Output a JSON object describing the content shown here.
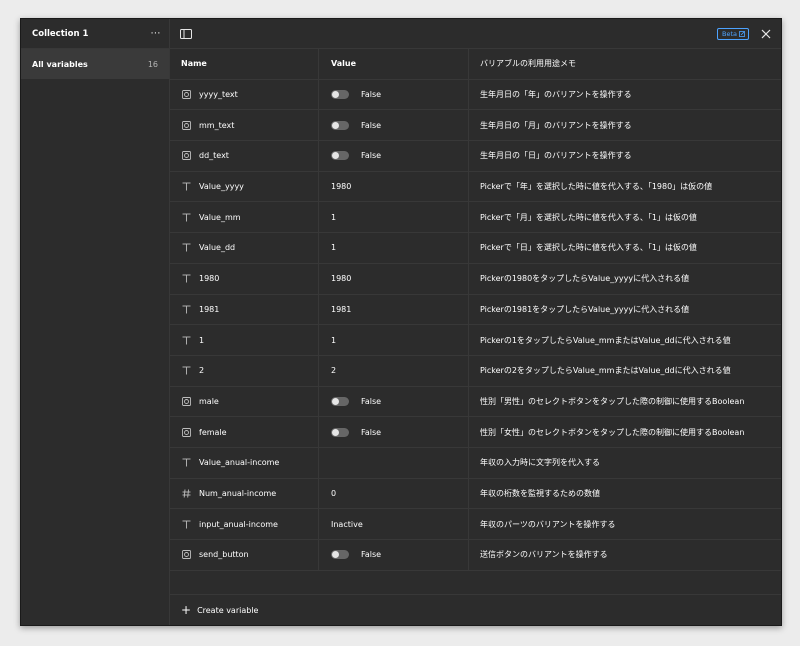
{
  "sidebar": {
    "collection_title": "Collection 1",
    "more_icon": "⋯",
    "items": [
      {
        "label": "All variables",
        "count": "16"
      }
    ]
  },
  "topbar": {
    "beta_label": "Beta"
  },
  "table": {
    "headers": {
      "name": "Name",
      "value": "Value",
      "memo": "バリアブルの利用用途メモ"
    },
    "rows": [
      {
        "type": "boolean",
        "name": "yyyy_text",
        "value": "False",
        "memo": "生年月日の「年」のバリアントを操作する"
      },
      {
        "type": "boolean",
        "name": "mm_text",
        "value": "False",
        "memo": "生年月日の「月」のバリアントを操作する"
      },
      {
        "type": "boolean",
        "name": "dd_text",
        "value": "False",
        "memo": "生年月日の「日」のバリアントを操作する"
      },
      {
        "type": "string",
        "name": "Value_yyyy",
        "value": "1980",
        "memo": "Pickerで「年」を選択した時に値を代入する、「1980」は仮の値"
      },
      {
        "type": "string",
        "name": "Value_mm",
        "value": "1",
        "memo": "Pickerで「月」を選択した時に値を代入する、「1」は仮の値"
      },
      {
        "type": "string",
        "name": "Value_dd",
        "value": "1",
        "memo": "Pickerで「日」を選択した時に値を代入する、「1」は仮の値"
      },
      {
        "type": "string",
        "name": "1980",
        "value": "1980",
        "memo": "Pickerの1980をタップしたらValue_yyyyに代入される値"
      },
      {
        "type": "string",
        "name": "1981",
        "value": "1981",
        "memo": "Pickerの1981をタップしたらValue_yyyyに代入される値"
      },
      {
        "type": "string",
        "name": "1",
        "value": "1",
        "memo": "Pickerの1をタップしたらValue_mmまたはValue_ddに代入される値"
      },
      {
        "type": "string",
        "name": "2",
        "value": "2",
        "memo": "Pickerの2をタップしたらValue_mmまたはValue_ddに代入される値"
      },
      {
        "type": "boolean",
        "name": "male",
        "value": "False",
        "memo": "性別「男性」のセレクトボタンをタップした際の制御に使用するBoolean"
      },
      {
        "type": "boolean",
        "name": "female",
        "value": "False",
        "memo": "性別「女性」のセレクトボタンをタップした際の制御に使用するBoolean"
      },
      {
        "type": "string",
        "name": "Value_anual-income",
        "value": "",
        "memo": "年収の入力時に文字列を代入する"
      },
      {
        "type": "number",
        "name": "Num_anual-income",
        "value": "0",
        "memo": "年収の桁数を監視するための数値"
      },
      {
        "type": "string",
        "name": "input_anual-income",
        "value": "Inactive",
        "memo": "年収のパーツのバリアントを操作する"
      },
      {
        "type": "boolean",
        "name": "send_button",
        "value": "False",
        "memo": "送信ボタンのバリアントを操作する"
      }
    ]
  },
  "footer": {
    "create_label": "Create variable"
  },
  "colors": {
    "accent": "#4da3ff",
    "panel": "#2c2c2c",
    "divider": "#383838"
  }
}
